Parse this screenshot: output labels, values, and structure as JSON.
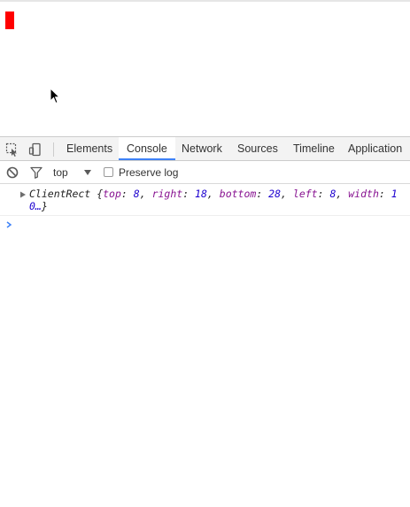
{
  "page": {
    "red_box_color": "#ff0000"
  },
  "devtools": {
    "tabs": [
      {
        "label": "Elements"
      },
      {
        "label": "Console"
      },
      {
        "label": "Network"
      },
      {
        "label": "Sources"
      },
      {
        "label": "Timeline"
      },
      {
        "label": "Application"
      }
    ],
    "active_tab": "Console",
    "icons": [
      "inspect-element-icon",
      "device-toolbar-icon"
    ]
  },
  "console": {
    "toolbar": {
      "clear_icon": "clear-console-icon",
      "filter_icon": "filter-icon",
      "context": "top",
      "preserve_log_label": "Preserve log",
      "preserve_log_checked": false
    },
    "entry": {
      "class_name": "ClientRect",
      "open_brace": "{",
      "props": [
        {
          "key": "top",
          "value": "8"
        },
        {
          "key": "right",
          "value": "18"
        },
        {
          "key": "bottom",
          "value": "28"
        },
        {
          "key": "left",
          "value": "8"
        },
        {
          "key": "width",
          "value": "10…"
        }
      ],
      "close_brace": "}"
    },
    "prompt_icon": "prompt-chevron-icon"
  }
}
